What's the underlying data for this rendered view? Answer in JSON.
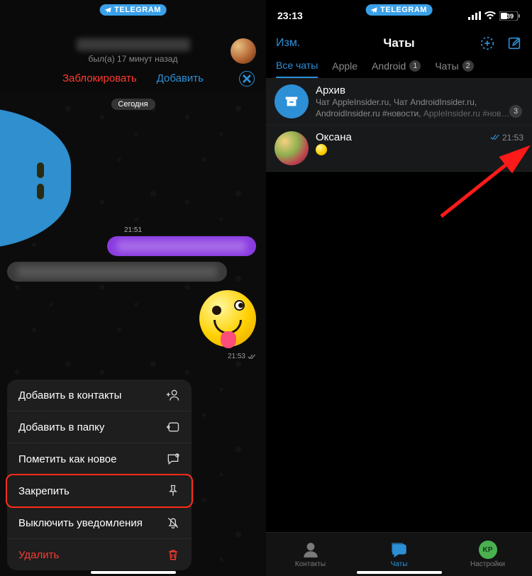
{
  "left": {
    "app_pill": "TELEGRAM",
    "last_seen": "был(а) 17 минут назад",
    "block_label": "Заблокировать",
    "add_label": "Добавить",
    "today_label": "Сегодня",
    "msg_time_1": "21:51",
    "sent_time": "21:53",
    "menu": {
      "add_contact": "Добавить в контакты",
      "add_folder": "Добавить в папку",
      "mark_new": "Пометить как новое",
      "pin": "Закрепить",
      "mute": "Выключить уведомления",
      "delete": "Удалить"
    }
  },
  "right": {
    "status_time": "23:13",
    "battery": "39",
    "app_pill": "TELEGRAM",
    "nav_edit": "Изм.",
    "nav_title": "Чаты",
    "tabs": {
      "all": "Все чаты",
      "apple": "Apple",
      "android": "Android",
      "android_badge": "1",
      "chats": "Чаты",
      "chats_badge": "2"
    },
    "archive": {
      "title": "Архив",
      "subtitle_a": "Чат AppleInsider.ru, Чат AndroidInsider.ru, AndroidInsider.ru #новости,",
      "subtitle_b": " AppleInsider.ru #нов…",
      "badge": "3"
    },
    "chat1": {
      "title": "Оксана",
      "time": "21:53"
    },
    "tabbar": {
      "contacts": "Контакты",
      "chats": "Чаты",
      "settings": "Настройки",
      "initials": "KP"
    }
  }
}
